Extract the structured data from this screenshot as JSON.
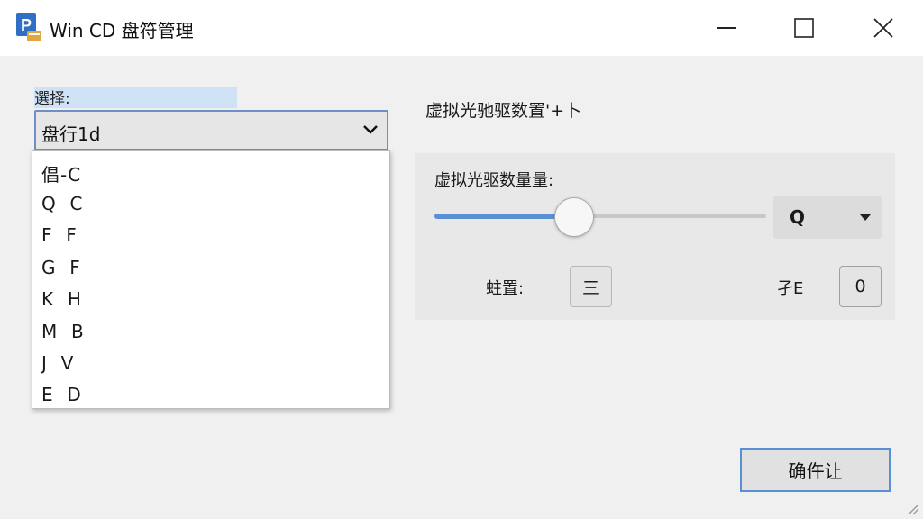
{
  "window": {
    "title": "Win CD 盘符管理",
    "app_icon": "app-drive-icon",
    "controls": [
      "minimize-icon",
      "maximize-icon",
      "close-icon"
    ]
  },
  "left": {
    "label": "選择:",
    "combo_value": "盘行1d",
    "dropdown_items": [
      "倡-C",
      "Q  C",
      "F  F",
      "G  F",
      "K  H",
      "M  B",
      "J  V",
      "E  D"
    ]
  },
  "right": {
    "heading": "虚拟光驰驱数置'+卜",
    "panel_label": "虚拟光驱数量量:",
    "slider_fraction": 0.37,
    "unit_value": "Q",
    "position_label": "蛀置:",
    "position_value": "三",
    "ze_label": "孑E",
    "ze_value": "0"
  },
  "buttons": {
    "ok": "确仵让"
  },
  "colors": {
    "accent": "#5b8fd3",
    "selection": "#cfe2f5"
  }
}
